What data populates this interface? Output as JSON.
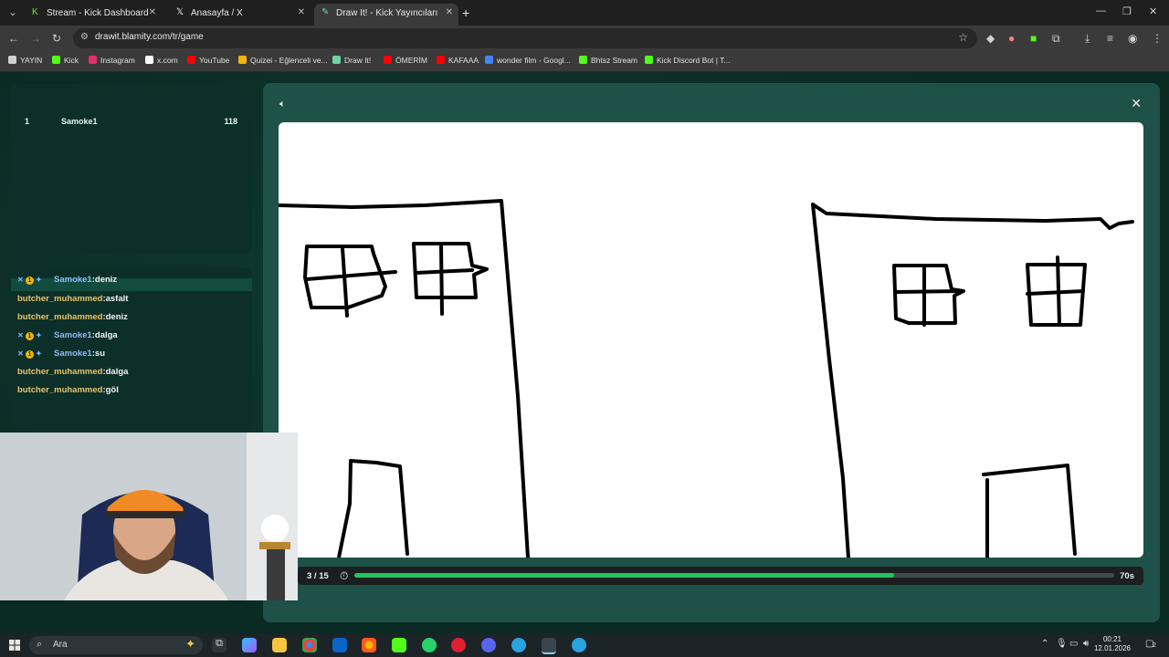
{
  "browser": {
    "tabs": [
      {
        "label": "Stream - Kick Dashboard",
        "icon": "kick-icon",
        "color": "#53fc18"
      },
      {
        "label": "Anasayfa / X",
        "icon": "x-icon",
        "color": "#ffffff"
      },
      {
        "label": "Draw It! - Kick Yayıncıları İçin",
        "icon": "pencil-icon",
        "color": "#6dd3a0"
      }
    ],
    "url": "drawit.blamity.com/tr/game",
    "bookmarks": [
      {
        "label": "YAYIN",
        "color": "#cfcfcf"
      },
      {
        "label": "Kick",
        "color": "#53fc18"
      },
      {
        "label": "Instagram",
        "color": "#e1306c"
      },
      {
        "label": "x.com",
        "color": "#ffffff"
      },
      {
        "label": "YouTube",
        "color": "#ff0000"
      },
      {
        "label": "Quizei - Eğlenceli ve...",
        "color": "#f2b705"
      },
      {
        "label": "Draw It!",
        "color": "#6dd3a0"
      },
      {
        "label": "ÖMERİM",
        "color": "#ff0000"
      },
      {
        "label": "KAFAAA",
        "color": "#ff0000"
      },
      {
        "label": "wonder film - Googl...",
        "color": "#4285f4"
      },
      {
        "label": "Bhtsz Stream",
        "color": "#53fc18"
      },
      {
        "label": "Kick Discord Bot | T...",
        "color": "#53fc18"
      }
    ]
  },
  "leaderboard": [
    {
      "rank": "1",
      "name": "Samoke1",
      "score": "118"
    }
  ],
  "chat": [
    {
      "user": "Samoke1",
      "msg": "deniz",
      "badges": true,
      "style": "blue",
      "partial": true
    },
    {
      "user": "butcher_muhammed",
      "msg": "asfalt",
      "badges": false,
      "style": "gold"
    },
    {
      "user": "butcher_muhammed",
      "msg": "deniz",
      "badges": false,
      "style": "gold"
    },
    {
      "user": "Samoke1",
      "msg": "dalga",
      "badges": true,
      "style": "blue"
    },
    {
      "user": "Samoke1",
      "msg": "su",
      "badges": true,
      "style": "blue"
    },
    {
      "user": "butcher_muhammed",
      "msg": "dalga",
      "badges": false,
      "style": "gold"
    },
    {
      "user": "butcher_muhammed",
      "msg": "göl",
      "badges": false,
      "style": "gold"
    }
  ],
  "game": {
    "round": "3 / 15",
    "time_left": "70s",
    "progress": 0.71
  },
  "taskbar": {
    "search_placeholder": "Ara",
    "time": "00:21",
    "date": "12.01.2026",
    "notifications": "2"
  }
}
